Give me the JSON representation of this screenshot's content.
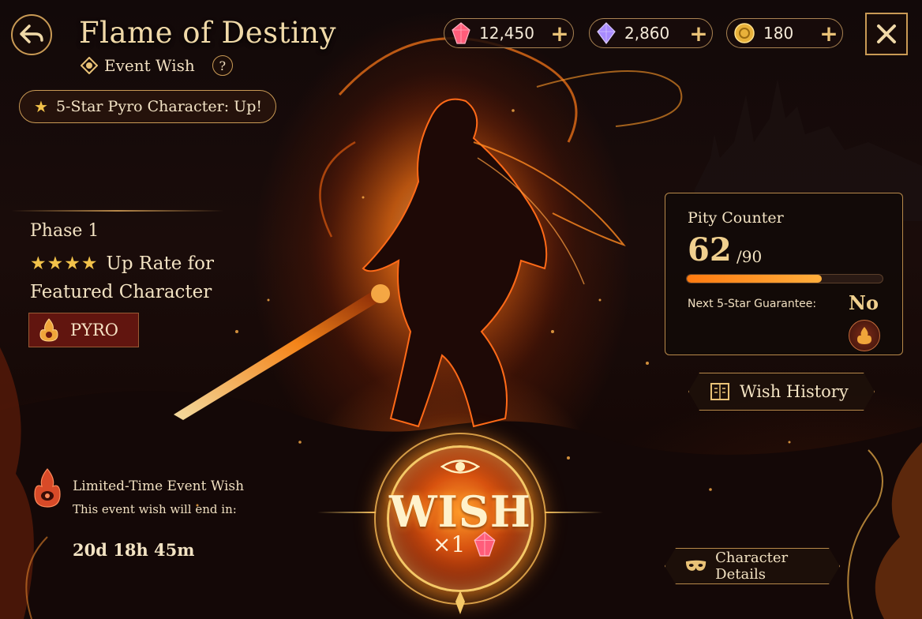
{
  "header": {
    "title": "Flame of Destiny",
    "subtitle": "Event Wish",
    "help_label": "?",
    "banner": "5-Star Pyro Character: Up!"
  },
  "currencies": [
    {
      "icon": "red-crystal-icon",
      "value": "12,450",
      "plus": "+"
    },
    {
      "icon": "purple-crystal-icon",
      "value": "2,860",
      "plus": "+"
    },
    {
      "icon": "gold-coin-icon",
      "value": "180",
      "plus": "+"
    }
  ],
  "info": {
    "phase": "Phase 1",
    "stars": "★★★★",
    "rate_line1": "Up Rate for",
    "rate_line2": "Featured Character",
    "element": "PYRO"
  },
  "limited": {
    "title": "Limited-Time Event Wish",
    "desc": "This event wish will end in:",
    "countdown": "20d 18h 45m"
  },
  "pity": {
    "title": "Pity Counter",
    "count": "62",
    "max": "/90",
    "progress": 0.689,
    "guarantee_label": "Next 5-Star Guarantee:",
    "guarantee_value": "No"
  },
  "buttons": {
    "history": "Wish History",
    "details": "Character Details"
  },
  "wish": {
    "label": "WISH",
    "cost": "×1"
  },
  "colors": {
    "accent_gold": "#e9c277",
    "fire_orange": "#ff7a10",
    "pyro_red": "#6e1810"
  }
}
